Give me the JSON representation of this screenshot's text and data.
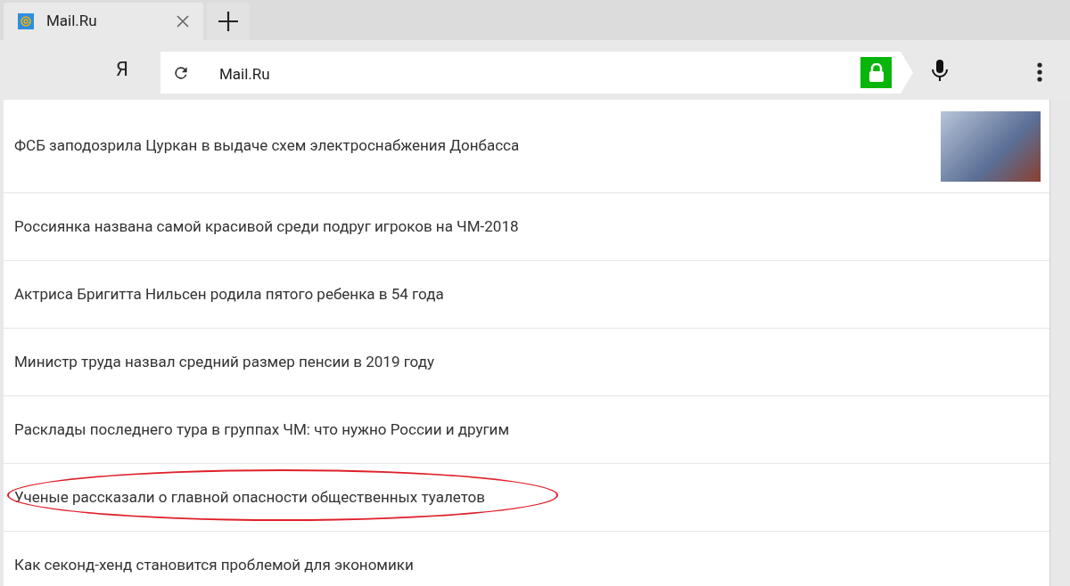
{
  "tabs": [
    {
      "title": "Mail.Ru",
      "selected": true
    }
  ],
  "toolbar": {
    "search_logo": "Я",
    "address": "Mail.Ru",
    "secure": true
  },
  "news": [
    {
      "title": "ФСБ заподозрила Цуркан в выдаче схем электроснабжения Донбасса",
      "has_photo": true,
      "circled": false
    },
    {
      "title": "Россиянка названа самой красивой среди подруг игроков на ЧМ-2018",
      "has_photo": false,
      "circled": false
    },
    {
      "title": "Актриса Бригитта Нильсен родила пятого ребенка в 54 года",
      "has_photo": false,
      "circled": false
    },
    {
      "title": "Министр труда назвал средний размер пенсии в 2019 году",
      "has_photo": false,
      "circled": false
    },
    {
      "title": "Расклады последнего тура в группах ЧМ: что нужно России и другим",
      "has_photo": false,
      "circled": false
    },
    {
      "title": "Ученые рассказали о главной опасности общественных туалетов",
      "has_photo": false,
      "circled": true
    },
    {
      "title": "Как секонд-хенд становится проблемой для экономики",
      "has_photo": false,
      "circled": false
    }
  ]
}
